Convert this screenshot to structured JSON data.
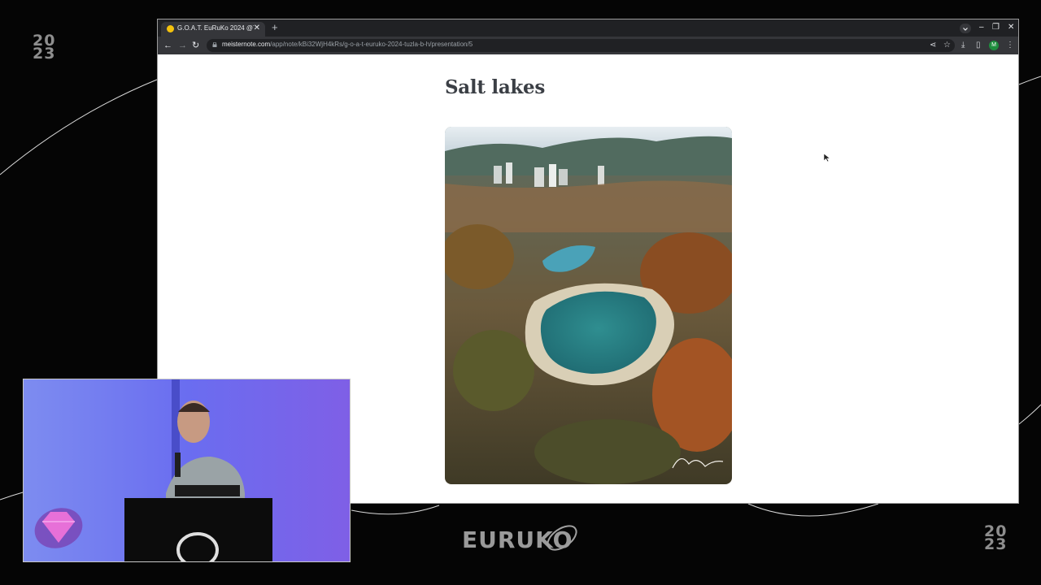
{
  "event": {
    "year_top": "20",
    "year_bottom": "23",
    "logo_text": "EURUKO"
  },
  "browser": {
    "tab": {
      "title": "G.O.A.T. EuRuKo 2024 @T",
      "close_icon": "close-icon",
      "favicon": "favicon-icon"
    },
    "new_tab_symbol": "+",
    "window_controls": {
      "minimize": "–",
      "restore": "❐",
      "close": "✕"
    },
    "nav": {
      "back": "←",
      "forward": "→",
      "reload": "↻"
    },
    "address": {
      "host": "meisternote.com",
      "path": "/app/note/kBi32WjH4kRs/g-o-a-t-euruko-2024-tuzla-b-h/presentation/5"
    },
    "toolbar_icons": {
      "share": "⋖",
      "bookmark": "☆",
      "download": "⤓",
      "sidebar": "▯",
      "menu": "⋮"
    },
    "profile_initial": "M",
    "accent_color": "#1e8e3e"
  },
  "slide": {
    "title": "Salt lakes",
    "image": {
      "subject": "aerial view of salt lakes in a city",
      "colors": {
        "lake": "#2e8a8d",
        "sky": "#dfe9ee",
        "foliage": "#b5652a"
      }
    }
  },
  "speaker": {
    "background_color": "#6f67f2"
  }
}
